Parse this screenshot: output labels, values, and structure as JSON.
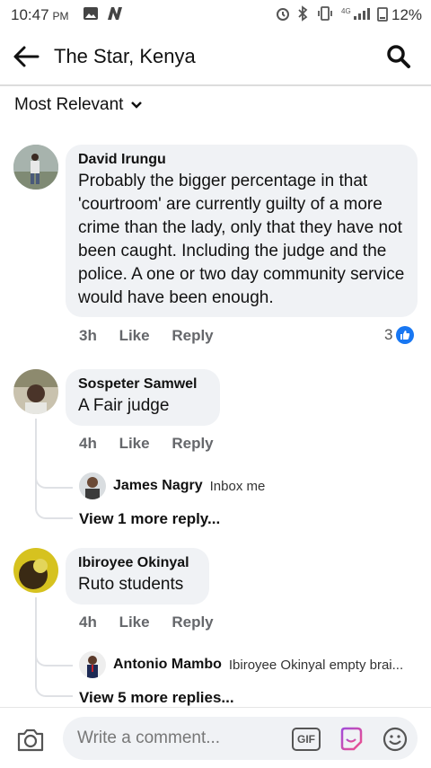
{
  "status_bar": {
    "time": "10:47",
    "ampm": "PM",
    "battery": "12%"
  },
  "header": {
    "title": "The Star, Kenya"
  },
  "filter": {
    "label": "Most Relevant"
  },
  "comments": [
    {
      "author": "David Irungu",
      "text": "Probably the bigger percentage in that 'courtroom' are currently guilty of a more crime than the lady, only that they have not been caught. Including the judge and the police. A one or two day community service would have been enough.",
      "age": "3h",
      "like": "Like",
      "reply": "Reply",
      "reaction_count": "3"
    },
    {
      "author": "Sospeter Samwel",
      "text": "A Fair judge",
      "age": "4h",
      "like": "Like",
      "reply": "Reply",
      "reply_preview": {
        "author": "James Nagry",
        "text": "Inbox me"
      },
      "more_replies": "View 1 more reply..."
    },
    {
      "author": "Ibiroyee Okinyal",
      "text": "Ruto students",
      "age": "4h",
      "like": "Like",
      "reply": "Reply",
      "reply_preview": {
        "author": "Antonio Mambo",
        "text": "Ibiroyee Okinyal empty brai..."
      },
      "more_replies": "View 5 more replies..."
    }
  ],
  "composer": {
    "placeholder": "Write a comment...",
    "gif_label": "GIF"
  },
  "colors": {
    "like_blue": "#1877f2",
    "bubble_bg": "#f0f2f5",
    "meta_gray": "#65676b"
  }
}
